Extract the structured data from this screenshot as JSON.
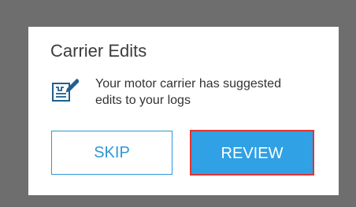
{
  "dialog": {
    "title": "Carrier Edits",
    "message_line1": "Your motor carrier has suggested",
    "message_line2": "edits to your logs",
    "icon": "edit-log-icon",
    "skip_label": "SKIP",
    "review_label": "REVIEW"
  },
  "colors": {
    "backdrop": "#6e6e6e",
    "dialog_bg": "#ffffff",
    "accent": "#2f97d6",
    "primary_button": "#2fa1e4",
    "highlight_border": "#e03434",
    "icon_color": "#1f5f8f"
  }
}
